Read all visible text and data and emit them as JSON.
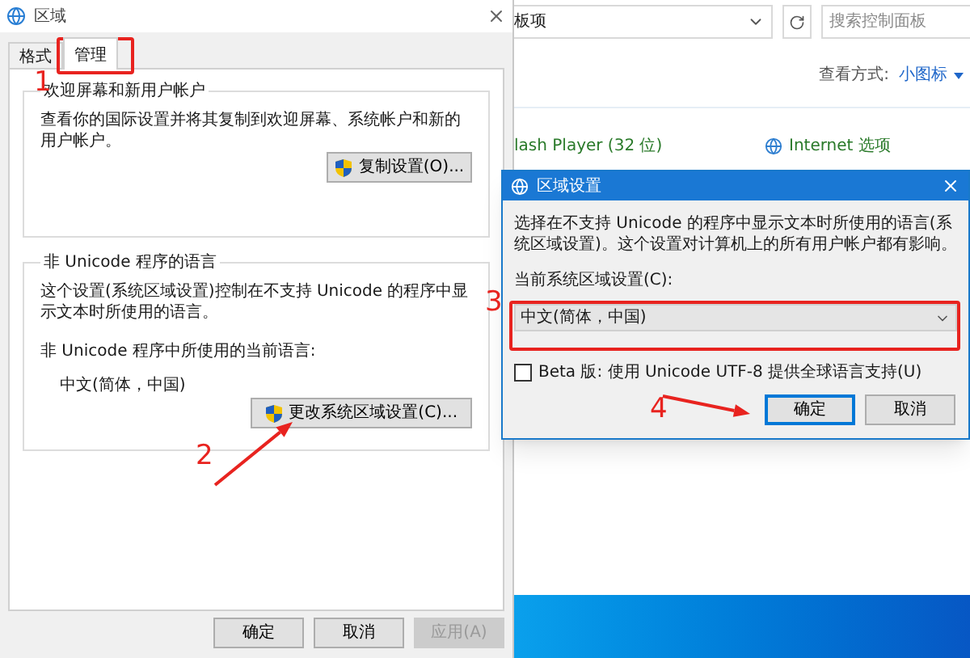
{
  "control_panel": {
    "address": "板项",
    "search": {
      "placeholder": "搜索控制面板"
    },
    "view_label": "查看方式:",
    "view_value": "小图标",
    "items": [
      {
        "kind": "text",
        "label": "lash Player (32 位)"
      },
      {
        "kind": "icon",
        "label": "Internet 选项"
      }
    ]
  },
  "region_dialog": {
    "title": "区域",
    "tabs": [
      {
        "label": "格式",
        "selected": false
      },
      {
        "label": "管理",
        "selected": true
      }
    ],
    "groups": [
      {
        "title": "欢迎屏幕和新用户帐户",
        "description": "查看你的国际设置并将其复制到欢迎屏幕、系统帐户和新的用户帐户。",
        "button": "复制设置(O)..."
      },
      {
        "title": "非 Unicode 程序的语言",
        "description": "这个设置(系统区域设置)控制在不支持 Unicode 的程序中显示文本时所使用的语言。",
        "current_label": "非 Unicode 程序中所使用的当前语言:",
        "current_value": "中文(简体，中国)",
        "button": "更改系统区域设置(C)..."
      }
    ],
    "buttons": [
      {
        "label": "确定",
        "disabled": false
      },
      {
        "label": "取消",
        "disabled": false
      },
      {
        "label": "应用(A)",
        "disabled": true
      }
    ]
  },
  "locale_dialog": {
    "title": "区域设置",
    "description": "选择在不支持 Unicode 的程序中显示文本时所使用的语言(系统区域设置)。这个设置对计算机上的所有用户帐户都有影响。",
    "select_label": "当前系统区域设置(C):",
    "select_value": "中文(简体，中国)",
    "beta": {
      "label": "Beta 版: 使用 Unicode UTF-8 提供全球语言支持(U)",
      "checked": false
    },
    "buttons": [
      {
        "label": "确定",
        "default": true
      },
      {
        "label": "取消",
        "default": false
      }
    ]
  },
  "annotations": [
    "1",
    "2",
    "3",
    "4"
  ]
}
